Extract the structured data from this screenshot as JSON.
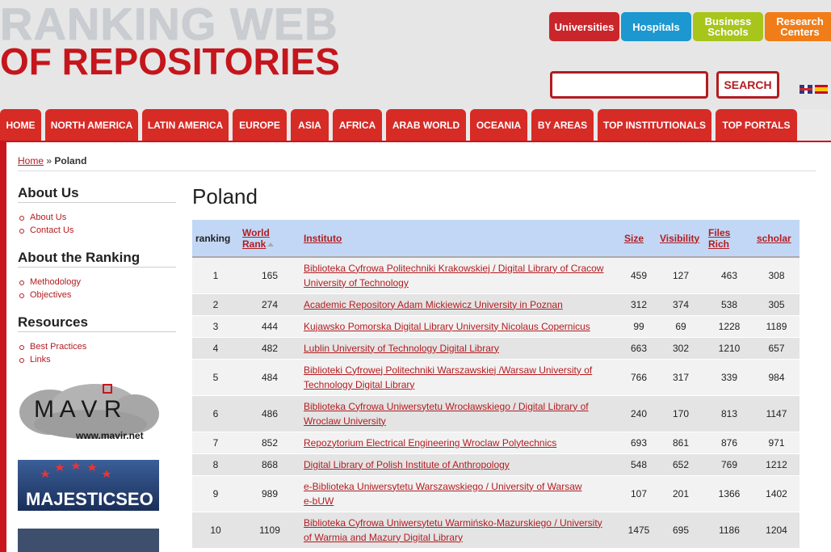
{
  "header": {
    "logo_line1": "RANKING WEB",
    "logo_line2": "OF REPOSITORIES",
    "top_buttons": [
      {
        "label_line1": "Universities",
        "label_line2": ""
      },
      {
        "label_line1": "Hospitals",
        "label_line2": ""
      },
      {
        "label_line1": "Business",
        "label_line2": "Schools"
      },
      {
        "label_line1": "Research",
        "label_line2": "Centers"
      }
    ],
    "search": {
      "value": "",
      "button_label": "SEARCH"
    },
    "flags": [
      "english-flag-icon",
      "spanish-flag-icon"
    ]
  },
  "nav": [
    "HOME",
    "NORTH AMERICA",
    "LATIN AMERICA",
    "EUROPE",
    "ASIA",
    "AFRICA",
    "ARAB WORLD",
    "OCEANIA",
    "BY AREAS",
    "TOP INSTITUTIONALS",
    "TOP PORTALS"
  ],
  "breadcrumb": {
    "home": "Home",
    "separator": "»",
    "current": "Poland"
  },
  "sidebar": {
    "about_us": {
      "title": "About Us",
      "links": [
        "About Us",
        "Contact Us"
      ]
    },
    "about_ranking": {
      "title": "About the Ranking",
      "links": [
        "Methodology",
        "Objectives"
      ]
    },
    "resources": {
      "title": "Resources",
      "links": [
        "Best Practices",
        "Links"
      ]
    },
    "ads": {
      "mavir_text": "M A V R",
      "mavir_url": "www.mavir.net",
      "majestic_text": "MAJESTICSEO"
    }
  },
  "main": {
    "title": "Poland",
    "columns": {
      "ranking": "ranking",
      "world_rank_1": "World",
      "world_rank_2": "Rank",
      "instituto": "Instituto",
      "size": "Size",
      "visibility": "Visibility",
      "files_rich_1": "Files",
      "files_rich_2": "Rich",
      "scholar": "scholar"
    },
    "rows": [
      {
        "ranking": "1",
        "world_rank": "165",
        "inst_1": "Biblioteka Cyfrowa Politechniki Krakowskiej / Digital Library of Cracow",
        "inst_2": "University of Technology",
        "size": "459",
        "visibility": "127",
        "files_rich": "463",
        "scholar": "308"
      },
      {
        "ranking": "2",
        "world_rank": "274",
        "inst_1": "Academic Repository Adam Mickiewicz University in Poznan",
        "inst_2": "",
        "size": "312",
        "visibility": "374",
        "files_rich": "538",
        "scholar": "305"
      },
      {
        "ranking": "3",
        "world_rank": "444",
        "inst_1": "Kujawsko Pomorska Digital Library University Nicolaus Copernicus",
        "inst_2": "",
        "size": "99",
        "visibility": "69",
        "files_rich": "1228",
        "scholar": "1189"
      },
      {
        "ranking": "4",
        "world_rank": "482",
        "inst_1": "Lublin University of Technology Digital Library",
        "inst_2": "",
        "size": "663",
        "visibility": "302",
        "files_rich": "1210",
        "scholar": "657"
      },
      {
        "ranking": "5",
        "world_rank": "484",
        "inst_1": "Biblioteki Cyfrowej Politechniki Warszawskiej /Warsaw University of",
        "inst_2": "Technology Digital Library",
        "size": "766",
        "visibility": "317",
        "files_rich": "339",
        "scholar": "984"
      },
      {
        "ranking": "6",
        "world_rank": "486",
        "inst_1": "Biblioteka Cyfrowa Uniwersytetu Wrocławskiego / Digital Library of",
        "inst_2": "Wroclaw University",
        "size": "240",
        "visibility": "170",
        "files_rich": "813",
        "scholar": "1147"
      },
      {
        "ranking": "7",
        "world_rank": "852",
        "inst_1": "Repozytorium Electrical Engineering Wroclaw Polytechnics",
        "inst_2": "",
        "size": "693",
        "visibility": "861",
        "files_rich": "876",
        "scholar": "971"
      },
      {
        "ranking": "8",
        "world_rank": "868",
        "inst_1": "Digital Library of Polish Institute of Anthropology",
        "inst_2": "",
        "size": "548",
        "visibility": "652",
        "files_rich": "769",
        "scholar": "1212"
      },
      {
        "ranking": "9",
        "world_rank": "989",
        "inst_1": "e-Biblioteka Uniwersytetu Warszawskiego / University of Warsaw",
        "inst_2": "e-bUW",
        "size": "107",
        "visibility": "201",
        "files_rich": "1366",
        "scholar": "1402"
      },
      {
        "ranking": "10",
        "world_rank": "1109",
        "inst_1": "Biblioteka Cyfrowa Uniwersytetu Warmińsko-Mazurskiego / University",
        "inst_2": "of Warmia and Mazury Digital Library",
        "size": "1475",
        "visibility": "695",
        "files_rich": "1186",
        "scholar": "1204"
      }
    ]
  },
  "colors": {
    "brand_red": "#c9161c",
    "header_blue": "#c2d7f5",
    "universities": "#c9262b",
    "hospitals": "#1d97cf",
    "business": "#a8c51c",
    "research": "#f07d18"
  }
}
